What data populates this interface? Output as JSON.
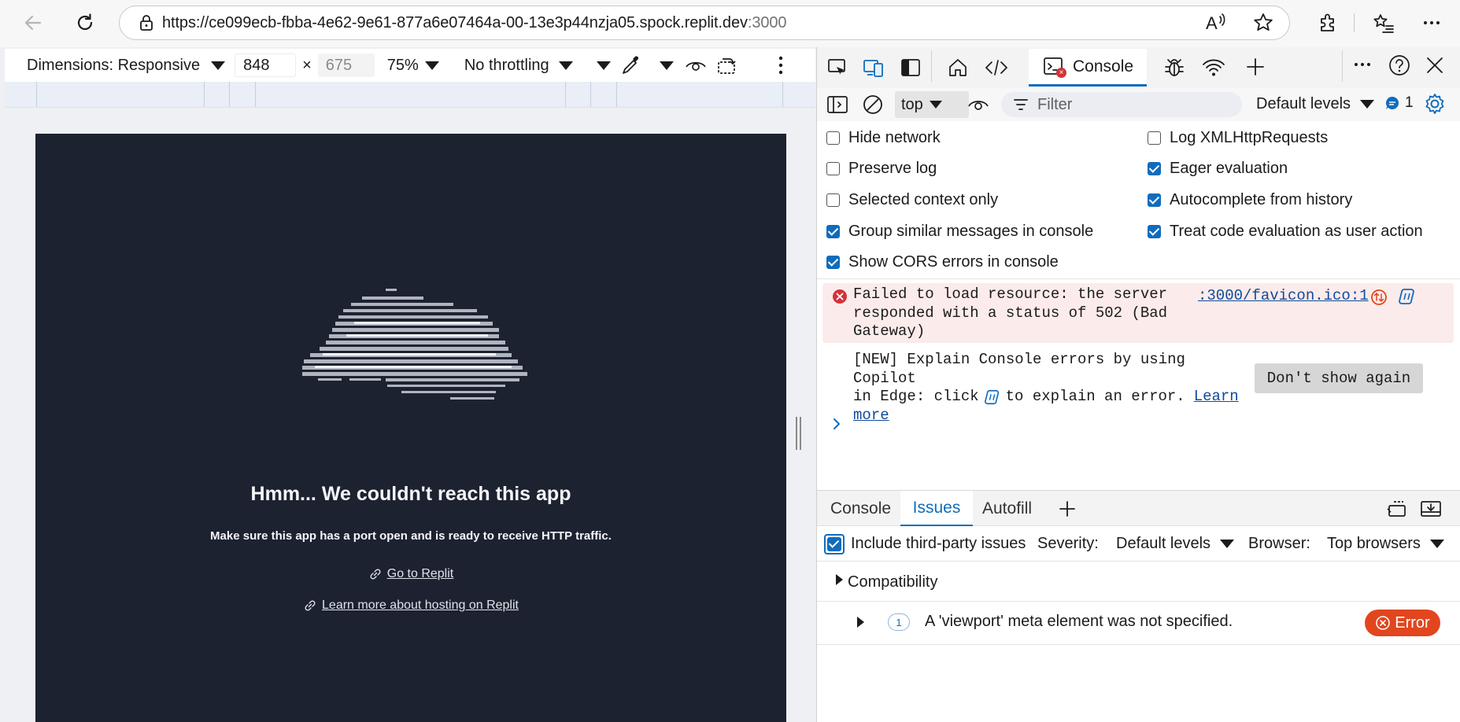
{
  "browser": {
    "url_main": "https://ce099ecb-fbba-4e62-9e61-877a6e07464a-00-13e3p44nzja05.spock.replit.dev",
    "url_port": ":3000"
  },
  "emulation": {
    "dimensions_label": "Dimensions: Responsive",
    "width_value": "848",
    "times": "×",
    "height_placeholder": "675",
    "zoom": "75%",
    "throttling": "No throttling"
  },
  "app_page": {
    "title": "Hmm... We couldn't reach this app",
    "subtitle": "Make sure this app has a port open and is ready to receive HTTP traffic.",
    "link_replit": "Go to Replit",
    "link_hosting": "Learn more about hosting on Replit",
    "bg_color": "#1c2230"
  },
  "devtools": {
    "active_tab": "Console",
    "context": "top",
    "filter_placeholder": "Filter",
    "levels": "Default levels",
    "issue_count": "1",
    "settings": {
      "hide_network": "Hide network",
      "preserve_log": "Preserve log",
      "selected_context": "Selected context only",
      "group_similar": "Group similar messages in console",
      "show_cors": "Show CORS errors in console",
      "log_xhr": "Log XMLHttpRequests",
      "eager_eval": "Eager evaluation",
      "autocomplete": "Autocomplete from history",
      "treat_code": "Treat code evaluation as user action"
    },
    "error_message": {
      "line1": "Failed to load resource: the server",
      "line2": "responded with a status of 502 (Bad",
      "line3": "Gateway)",
      "source": ":3000/favicon.ico:1"
    },
    "copilot_tip": {
      "line1": "[NEW] Explain Console errors by using Copilot",
      "line2a": "in Edge: click",
      "line2b": "to explain an error.",
      "learn": "Learn",
      "more": "more",
      "button": "Don't show again"
    },
    "drawer": {
      "tabs": [
        "Console",
        "Issues",
        "Autofill"
      ],
      "include_third_party": "Include third-party issues",
      "severity_label": "Severity:",
      "severity_value": "Default levels",
      "browser_label": "Browser:",
      "browser_value": "Top browsers",
      "category": "Compatibility",
      "issue_count": "1",
      "issue_text": "A 'viewport' meta element was not specified.",
      "issue_badge": "Error"
    },
    "colors": {
      "accent": "#0f6cbd",
      "error_bg": "#fcebeb",
      "error_red": "#e2461e"
    }
  }
}
